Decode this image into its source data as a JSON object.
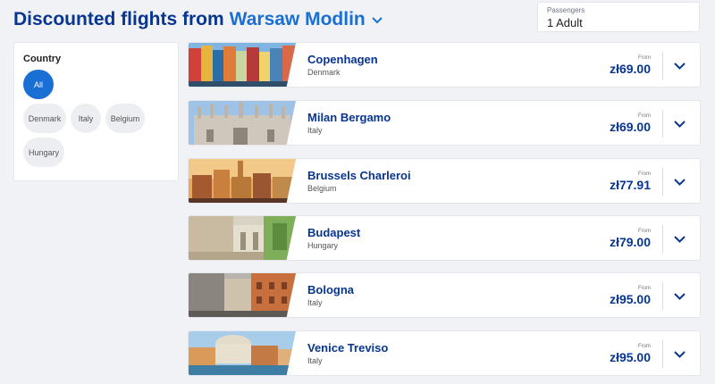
{
  "header": {
    "title_prefix": "Discounted flights from",
    "origin_city": "Warsaw Modlin"
  },
  "passengers": {
    "label": "Passengers",
    "value": "1 Adult"
  },
  "filter": {
    "heading": "Country",
    "chips": [
      "All",
      "Denmark",
      "Italy",
      "Belgium",
      "Hungary"
    ],
    "selected": "All"
  },
  "flights": [
    {
      "city": "Copenhagen",
      "country": "Denmark",
      "from_label": "From",
      "price": "zł69.00"
    },
    {
      "city": "Milan Bergamo",
      "country": "Italy",
      "from_label": "From",
      "price": "zł69.00"
    },
    {
      "city": "Brussels Charleroi",
      "country": "Belgium",
      "from_label": "From",
      "price": "zł77.91"
    },
    {
      "city": "Budapest",
      "country": "Hungary",
      "from_label": "From",
      "price": "zł79.00"
    },
    {
      "city": "Bologna",
      "country": "Italy",
      "from_label": "From",
      "price": "zł95.00"
    },
    {
      "city": "Venice Treviso",
      "country": "Italy",
      "from_label": "From",
      "price": "zł95.00"
    }
  ],
  "colors": {
    "brand_dark": "#073590",
    "brand_accent": "#1a6fd4",
    "background": "#f1f2f6"
  }
}
